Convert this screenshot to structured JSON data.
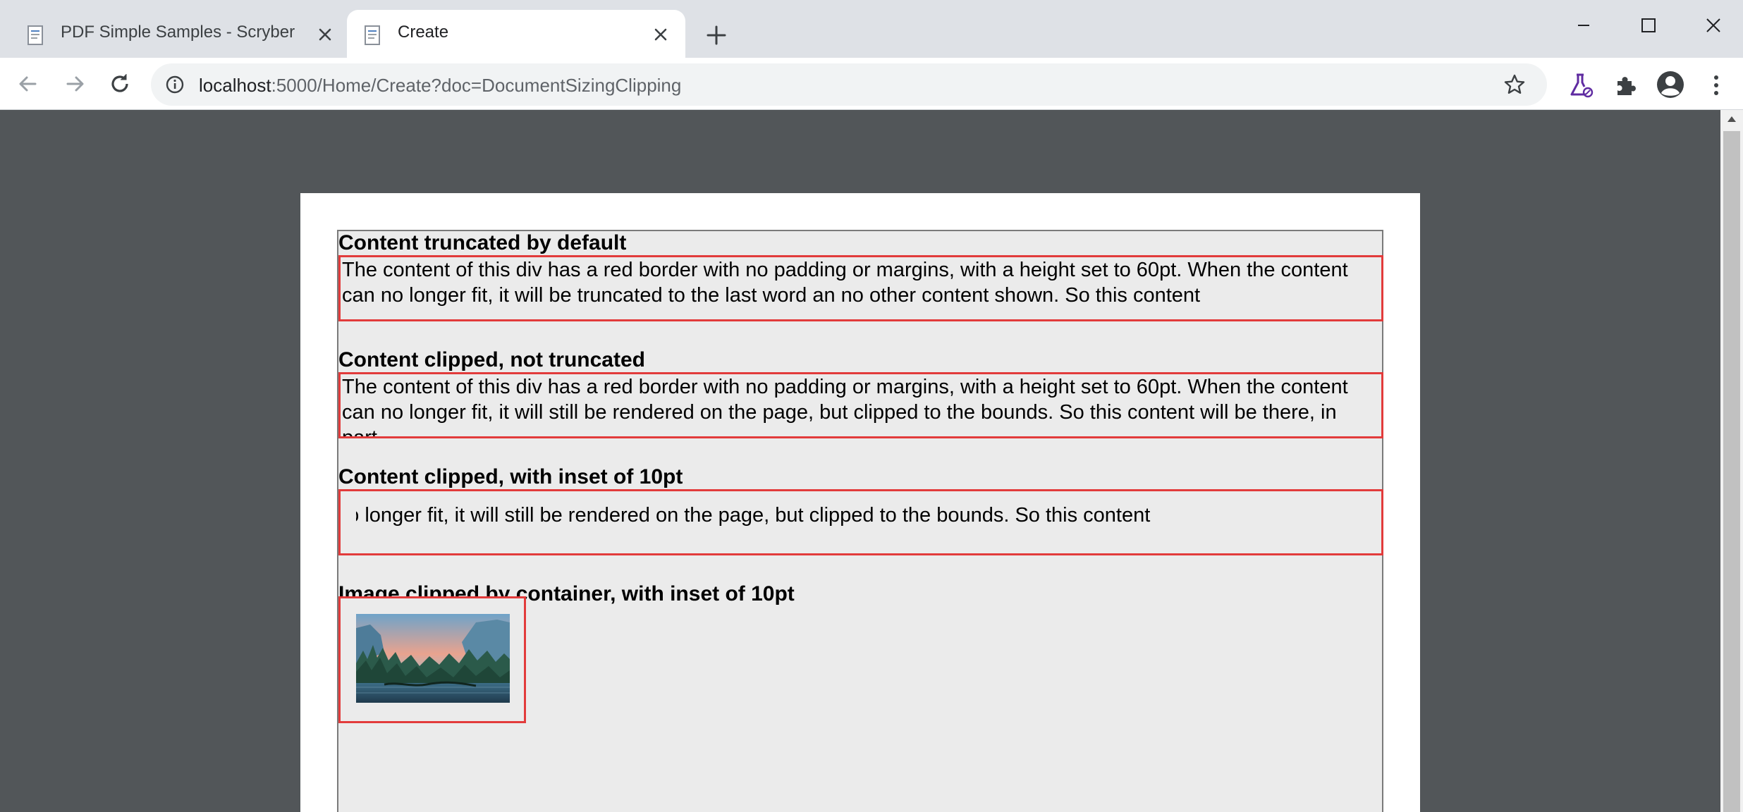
{
  "browser": {
    "tabs": [
      {
        "title": "PDF Simple Samples - Scryber",
        "active": false
      },
      {
        "title": "Create",
        "active": true
      }
    ],
    "address": {
      "host": "localhost",
      "path": ":5000/Home/Create?doc=DocumentSizingClipping"
    },
    "icons": {
      "back": "arrow-left-icon",
      "forward": "arrow-right-icon",
      "reload": "reload-icon",
      "info": "info-icon",
      "bookmark": "star-icon",
      "labs": "flask-icon",
      "extensions": "puzzle-icon",
      "profile": "account-icon",
      "menu": "kebab-menu-icon"
    }
  },
  "document": {
    "sections": [
      {
        "heading": "Content truncated by default",
        "text": "The content of this div has a red border with no padding or margins, with a height set to 60pt. When the content can no longer fit, it will be truncated to the last word an no other content shown. So this content"
      },
      {
        "heading": "Content clipped, not truncated",
        "text": "The content of this div has a red border with no padding or margins, with a height set to 60pt. When the content can no longer fit, it will still be rendered on the page, but clipped to the bounds. So this content will be there, in part."
      },
      {
        "heading": "Content clipped, with inset of 10pt",
        "text": "The content of this div has a red border with no padding or margins, with a height set to 60pt. When the content can no longer fit, it will still be rendered on the page, but clipped to the bounds. So this content"
      },
      {
        "heading": "Image clipped by container, with inset of 10pt"
      }
    ],
    "colors": {
      "border": "#e23b3b",
      "content_bg": "#ebebeb",
      "viewer_bg": "#525659"
    }
  }
}
